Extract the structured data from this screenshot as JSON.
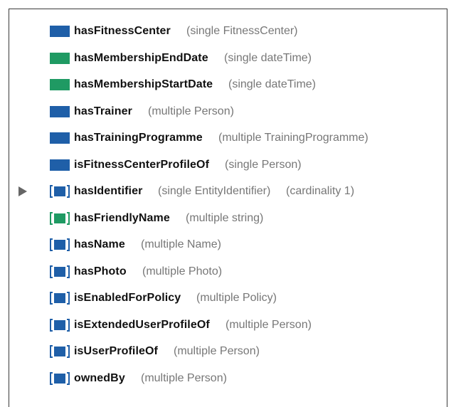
{
  "properties": [
    {
      "name": "hasFitnessCenter",
      "range": "(single FitnessCenter)",
      "kind": "object",
      "inherited": false
    },
    {
      "name": "hasMembershipEndDate",
      "range": "(single dateTime)",
      "kind": "datatype",
      "inherited": false
    },
    {
      "name": "hasMembershipStartDate",
      "range": "(single dateTime)",
      "kind": "datatype",
      "inherited": false
    },
    {
      "name": "hasTrainer",
      "range": "(multiple Person)",
      "kind": "object",
      "inherited": false
    },
    {
      "name": "hasTrainingProgramme",
      "range": "(multiple TrainingProgramme)",
      "kind": "object",
      "inherited": false
    },
    {
      "name": "isFitnessCenterProfileOf",
      "range": "(single Person)",
      "kind": "object",
      "inherited": false
    },
    {
      "name": "hasIdentifier",
      "range": "(single EntityIdentifier)",
      "cardinality": "(cardinality 1)",
      "kind": "object",
      "inherited": true,
      "expandable": true
    },
    {
      "name": "hasFriendlyName",
      "range": "(multiple string)",
      "kind": "datatype",
      "inherited": true
    },
    {
      "name": "hasName",
      "range": "(multiple Name)",
      "kind": "object",
      "inherited": true
    },
    {
      "name": "hasPhoto",
      "range": "(multiple Photo)",
      "kind": "object",
      "inherited": true
    },
    {
      "name": "isEnabledForPolicy",
      "range": "(multiple Policy)",
      "kind": "object",
      "inherited": true
    },
    {
      "name": "isExtendedUserProfileOf",
      "range": "(multiple Person)",
      "kind": "object",
      "inherited": true
    },
    {
      "name": "isUserProfileOf",
      "range": "(multiple Person)",
      "kind": "object",
      "inherited": true
    },
    {
      "name": "ownedBy",
      "range": "(multiple Person)",
      "kind": "object",
      "inherited": true
    }
  ],
  "colors": {
    "object_property": "#1f5fa8",
    "datatype_property": "#1f9a63",
    "label": "#111111",
    "range_text": "#777777",
    "expander": "#666666"
  }
}
